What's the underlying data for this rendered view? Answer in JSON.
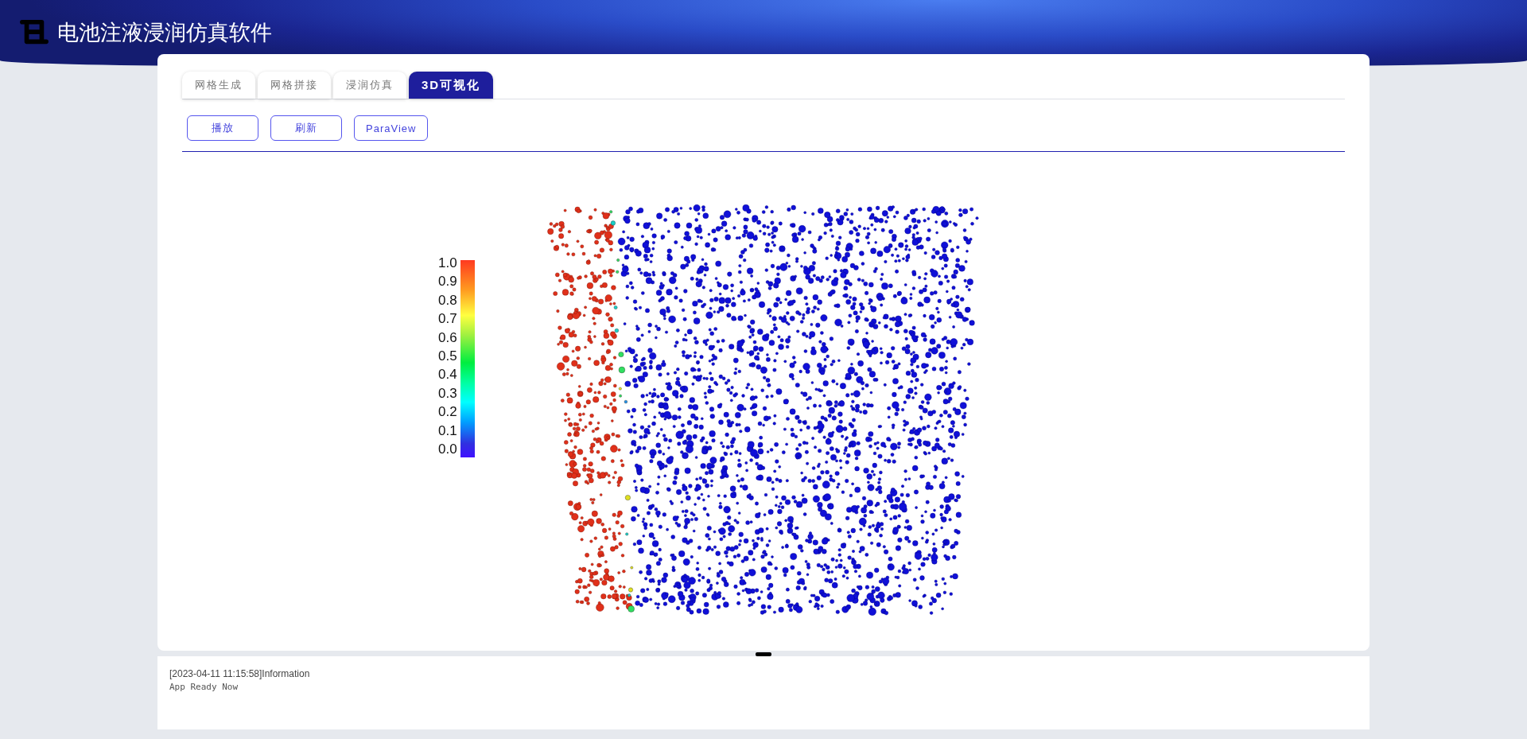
{
  "header": {
    "title": "电池注液浸润仿真软件"
  },
  "tabs": [
    {
      "label": "网格生成",
      "selected": false
    },
    {
      "label": "网格拼接",
      "selected": false
    },
    {
      "label": "浸润仿真",
      "selected": false
    },
    {
      "label": "3D可视化",
      "selected": true
    }
  ],
  "buttons": [
    "播放",
    "刷新",
    "ParaView"
  ],
  "colorbar": {
    "labels": [
      "1.0",
      "0.9",
      "0.8",
      "0.7",
      "0.6",
      "0.5",
      "0.4",
      "0.3",
      "0.2",
      "0.1",
      "0.0"
    ]
  },
  "log": {
    "entries": [
      {
        "heading": "[2023-04-11 11:15:58]Information",
        "message": "App Ready Now"
      }
    ]
  }
}
